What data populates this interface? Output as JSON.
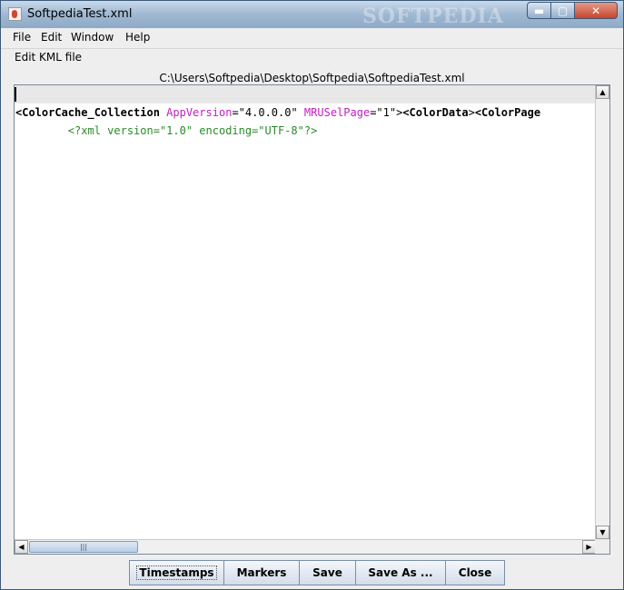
{
  "window": {
    "title": "SoftpediaTest.xml",
    "watermark": "SOFTPEDIA",
    "controls": {
      "minimize": "▬",
      "maximize": "▢",
      "close": "✕"
    }
  },
  "menu": {
    "items": [
      "File",
      "Edit",
      "Window",
      "Help"
    ]
  },
  "panel": {
    "label": "Edit KML file",
    "file_path": "C:\\Users\\Softpedia\\Desktop\\Softpedia\\SoftpediaTest.xml"
  },
  "editor": {
    "line1": {
      "text": "<?xml version=\"1.0\" encoding=\"UTF-8\"?>"
    },
    "line2": {
      "tag_open": "<ColorCache_Collection",
      "attr1_name": " AppVersion",
      "attr1_eq": "=\"",
      "attr1_value": "4.0.0.0",
      "attr1_close": "\"",
      "attr2_name": " MRUSelPage",
      "attr2_eq": "=\"",
      "attr2_value": "1",
      "attr2_close": "\">",
      "tag2": "<ColorData",
      "tag2_close": ">",
      "tag3": "<ColorPage"
    },
    "colors": {
      "declaration": "#2a8a2a",
      "attribute": "#c020c0",
      "tag": "#000000"
    }
  },
  "scrollbars": {
    "up_arrow": "▲",
    "down_arrow": "▼",
    "left_arrow": "◀",
    "right_arrow": "▶",
    "thumb_grip": "|||"
  },
  "buttons": {
    "timestamps": "Timestamps",
    "markers": "Markers",
    "save": "Save",
    "save_as": "Save As ...",
    "close": "Close"
  }
}
